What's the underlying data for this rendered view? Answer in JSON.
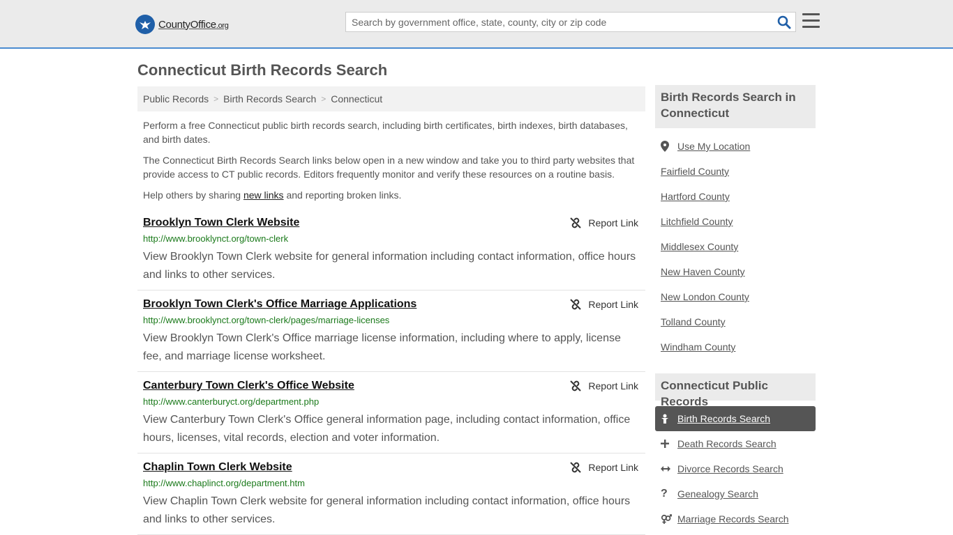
{
  "header": {
    "logo_text_main": "CountyOffice",
    "logo_text_domain": ".org",
    "search_placeholder": "Search by government office, state, county, city or zip code"
  },
  "page": {
    "title": "Connecticut Birth Records Search"
  },
  "breadcrumb": [
    "Public Records",
    "Birth Records Search",
    "Connecticut"
  ],
  "intro": {
    "p1": "Perform a free Connecticut public birth records search, including birth certificates, birth indexes, birth databases, and birth dates.",
    "p2": "The Connecticut Birth Records Search links below open in a new window and take you to third party websites that provide access to CT public records. Editors frequently monitor and verify these resources on a routine basis.",
    "p3_before": "Help others by sharing ",
    "p3_link": "new links",
    "p3_after": " and reporting broken links."
  },
  "report_label": "Report Link",
  "results": [
    {
      "title": "Brooklyn Town Clerk Website",
      "url": "http://www.brooklynct.org/town-clerk",
      "desc": "View Brooklyn Town Clerk website for general information including contact information, office hours and links to other services."
    },
    {
      "title": "Brooklyn Town Clerk's Office Marriage Applications",
      "url": "http://www.brooklynct.org/town-clerk/pages/marriage-licenses",
      "desc": "View Brooklyn Town Clerk's Office marriage license information, including where to apply, license fee, and marriage license worksheet."
    },
    {
      "title": "Canterbury Town Clerk's Office Website",
      "url": "http://www.canterburyct.org/department.php",
      "desc": "View Canterbury Town Clerk's Office general information page, including contact information, office hours, licenses, vital records, election and voter information."
    },
    {
      "title": "Chaplin Town Clerk Website",
      "url": "http://www.chaplinct.org/department.htm",
      "desc": "View Chaplin Town Clerk website for general information including contact information, office hours and links to other services."
    }
  ],
  "sidebar": {
    "counties_heading": "Birth Records Search in Connecticut",
    "use_location": "Use My Location",
    "counties": [
      "Fairfield County",
      "Hartford County",
      "Litchfield County",
      "Middlesex County",
      "New Haven County",
      "New London County",
      "Tolland County",
      "Windham County"
    ],
    "public_records_heading": "Connecticut Public Records",
    "public_records": [
      {
        "label": "Birth Records Search",
        "icon": "baby-icon"
      },
      {
        "label": "Death Records Search",
        "icon": "cross-icon"
      },
      {
        "label": "Divorce Records Search",
        "icon": "arrows-icon"
      },
      {
        "label": "Genealogy Search",
        "icon": "question-icon"
      },
      {
        "label": "Marriage Records Search",
        "icon": "gender-icon"
      }
    ]
  },
  "colors": {
    "accent_border": "#4a8bd0",
    "url_green": "#1b7a1b",
    "active_item_bg": "#555555"
  }
}
